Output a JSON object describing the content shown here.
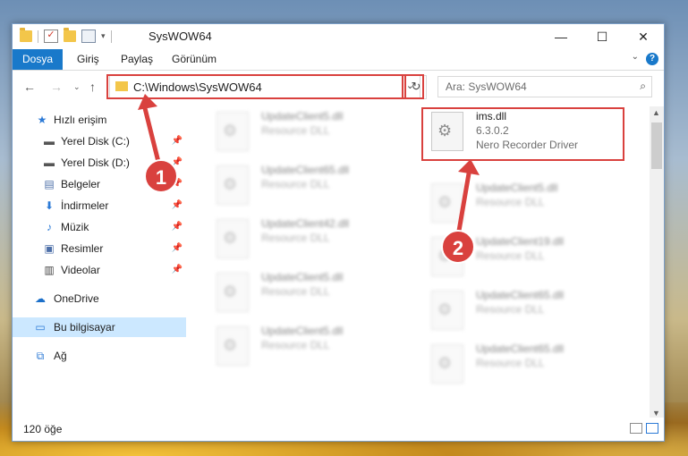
{
  "window": {
    "title": "SysWOW64",
    "minimize": "—",
    "maximize": "☐",
    "close": "✕"
  },
  "ribbon": {
    "tabs": [
      "Dosya",
      "Giriş",
      "Paylaş",
      "Görünüm"
    ],
    "help": "?"
  },
  "address": {
    "path": "C:\\Windows\\SysWOW64",
    "search_placeholder": "Ara: SysWOW64"
  },
  "sidebar": {
    "items": [
      {
        "label": "Hızlı erişim",
        "icon": "star-icon"
      },
      {
        "label": "Yerel Disk (C:)",
        "icon": "drive-icon",
        "pinned": true
      },
      {
        "label": "Yerel Disk (D:)",
        "icon": "drive-icon",
        "pinned": true
      },
      {
        "label": "Belgeler",
        "icon": "document-icon",
        "pinned": true
      },
      {
        "label": "İndirmeler",
        "icon": "download-icon",
        "pinned": true
      },
      {
        "label": "Müzik",
        "icon": "music-icon",
        "pinned": true
      },
      {
        "label": "Resimler",
        "icon": "pictures-icon",
        "pinned": true
      },
      {
        "label": "Videolar",
        "icon": "video-icon",
        "pinned": true
      },
      {
        "label": "OneDrive",
        "icon": "cloud-icon"
      },
      {
        "label": "Bu bilgisayar",
        "icon": "computer-icon",
        "selected": true
      },
      {
        "label": "Ağ",
        "icon": "network-icon"
      }
    ]
  },
  "files": {
    "highlighted": {
      "name": "ims.dll",
      "version": "6.3.0.2",
      "description": "Nero Recorder Driver"
    },
    "left_column": [
      {
        "name": "UpdateClient5.dll",
        "type": "Resource DLL"
      },
      {
        "name": "UpdateClient65.dll",
        "type": "Resource DLL"
      },
      {
        "name": "UpdateClient42.dll",
        "type": "Resource DLL"
      },
      {
        "name": "UpdateClient5.dll",
        "type": "Resource DLL"
      },
      {
        "name": "UpdateClient5.dll",
        "type": "Resource DLL"
      }
    ],
    "right_column": [
      {
        "name": "UpdateClient5.dll",
        "type": "Resource DLL"
      },
      {
        "name": "UpdateClient19.dll",
        "type": "Resource DLL"
      },
      {
        "name": "UpdateClient65.dll",
        "type": "Resource DLL"
      },
      {
        "name": "UpdateClient65.dll",
        "type": "Resource DLL"
      }
    ]
  },
  "status": {
    "count": "120 öğe"
  },
  "annotations": {
    "step1": "1",
    "step2": "2",
    "color": "#d9413e"
  }
}
